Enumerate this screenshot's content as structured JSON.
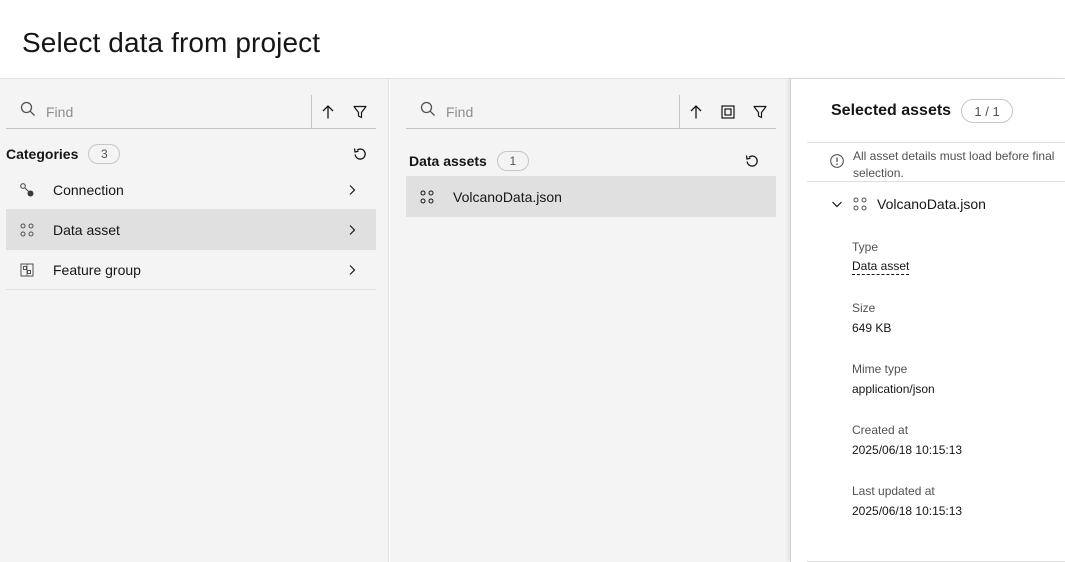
{
  "header": {
    "title": "Select data from project"
  },
  "categories_panel": {
    "search_placeholder": "Find",
    "title": "Categories",
    "count": "3",
    "items": [
      {
        "label": "Connection",
        "icon": "connection-icon",
        "active": false
      },
      {
        "label": "Data asset",
        "icon": "data-asset-icon",
        "active": true
      },
      {
        "label": "Feature group",
        "icon": "feature-group-icon",
        "active": false
      }
    ]
  },
  "assets_panel": {
    "search_placeholder": "Find",
    "title": "Data assets",
    "count": "1",
    "items": [
      {
        "label": "VolcanoData.json",
        "icon": "data-asset-icon"
      }
    ]
  },
  "selected_panel": {
    "title": "Selected assets",
    "count": "1 / 1",
    "notice_line1": "All asset details must load before final",
    "notice_line2": "selection.",
    "asset_name": "VolcanoData.json",
    "details": [
      {
        "key": "Type",
        "value": "Data asset",
        "link": true
      },
      {
        "key": "Size",
        "value": "649 KB",
        "link": false
      },
      {
        "key": "Mime type",
        "value": "application/json",
        "link": false
      },
      {
        "key": "Created at",
        "value": "2025/06/18 10:15:13",
        "link": false
      },
      {
        "key": "Last updated at",
        "value": "2025/06/18 10:15:13",
        "link": false
      }
    ]
  },
  "colors": {
    "panel_bg": "#f4f4f4",
    "selected_bg": "#e0e0e0",
    "text": "#161616",
    "muted": "#525252"
  }
}
